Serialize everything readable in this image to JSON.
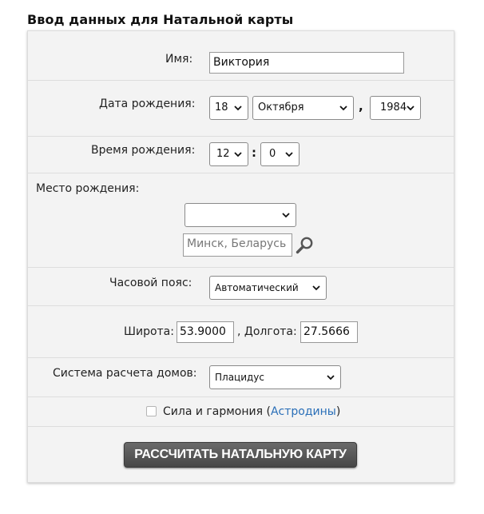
{
  "form": {
    "title": "Ввод данных для Натальной карты",
    "name": {
      "label": "Имя:",
      "value": "Виктория"
    },
    "birth_date": {
      "label": "Дата рождения:",
      "day": "18",
      "month": "Октября",
      "comma": ",",
      "year": "1984"
    },
    "birth_time": {
      "label": "Время рождения:",
      "hour": "12",
      "colon": ":",
      "minute": "0"
    },
    "birth_place": {
      "label": "Место рождения:",
      "select_value": "",
      "search_placeholder": "Минск, Беларусь"
    },
    "timezone": {
      "label": "Часовой пояс:",
      "value": "Автоматический"
    },
    "coordinates": {
      "lat_label": "Широта:",
      "lat_value": "53.9000",
      "lon_label": ", Долгота:",
      "lon_value": "27.5666"
    },
    "house_system": {
      "label": "Система расчета домов:",
      "value": "Плацидус"
    },
    "option": {
      "text": "Сила и гармония",
      "paren_open": "(",
      "link": "Астродины",
      "paren_close": ")",
      "checked": false
    },
    "submit_label": "РАССЧИТАТЬ НАТАЛЬНУЮ КАРТУ"
  }
}
